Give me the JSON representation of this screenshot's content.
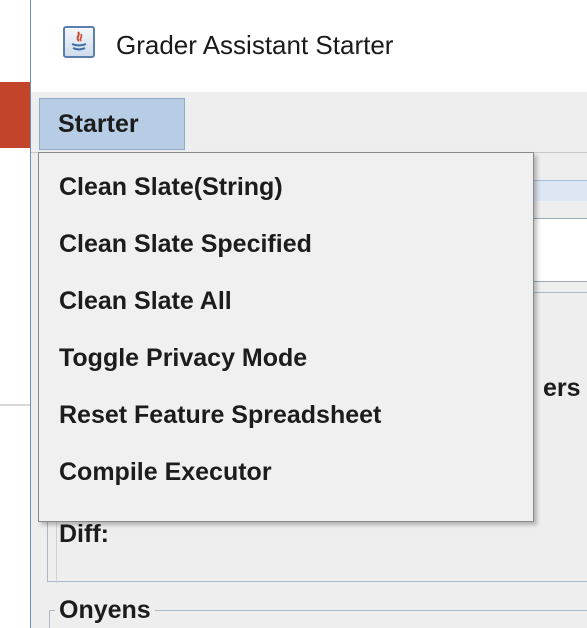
{
  "window": {
    "title": "Grader Assistant Starter",
    "icon": "java-app-icon"
  },
  "menubar": {
    "menus": [
      {
        "label": "Starter"
      }
    ]
  },
  "dropdown": {
    "items": [
      {
        "label": "Clean Slate(String)"
      },
      {
        "label": "Clean Slate Specified"
      },
      {
        "label": "Clean Slate All"
      },
      {
        "label": "Toggle Privacy Mode"
      },
      {
        "label": "Reset Feature Spreadsheet"
      },
      {
        "label": "Compile Executor"
      }
    ]
  },
  "background": {
    "partial_text": "ers",
    "diff_label": "Diff:",
    "onyens_label": "Onyens"
  },
  "colors": {
    "menu_active": "#b7cde6",
    "window_bg": "#eeeeee",
    "dropdown_bg": "#f0f0f0",
    "desktop_accent": "#c2452b"
  }
}
